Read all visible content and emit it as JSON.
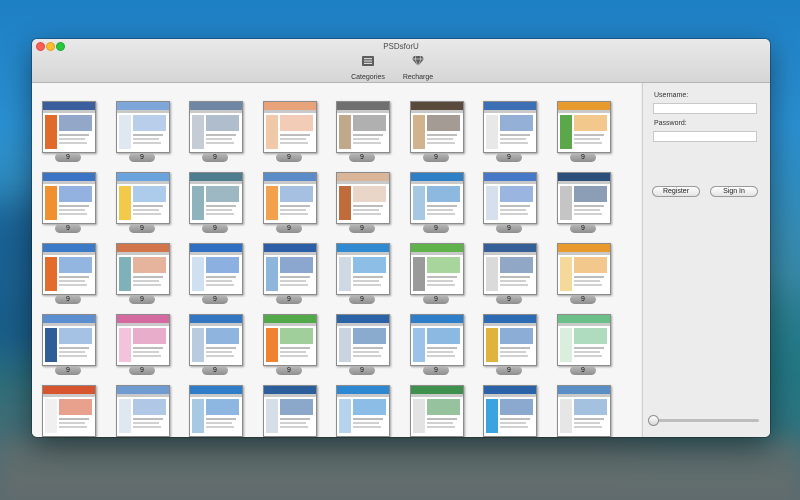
{
  "window": {
    "title": "PSDsforU"
  },
  "toolbar": {
    "items": [
      {
        "label": "Categories",
        "icon": "categories-icon"
      },
      {
        "label": "Recharge",
        "icon": "diamond-icon"
      }
    ]
  },
  "login": {
    "username_label": "Username:",
    "username_value": "",
    "password_label": "Password:",
    "password_value": "",
    "register_label": "Register",
    "signin_label": "Sign In"
  },
  "templates": {
    "badge": "9",
    "rows": [
      [
        {
          "accent": "#3b5f9c",
          "side": "#e06a2a"
        },
        {
          "accent": "#7ea6d8",
          "side": "#dfe7f2"
        },
        {
          "accent": "#6f86a4",
          "side": "#c5ccd6"
        },
        {
          "accent": "#e8a37a",
          "side": "#f0c9a8"
        },
        {
          "accent": "#707070",
          "side": "#bfa98a"
        },
        {
          "accent": "#5a4a3c",
          "side": "#d1b38e"
        },
        {
          "accent": "#3d6fb5",
          "side": "#e8e8e8"
        },
        {
          "accent": "#e79b2f",
          "side": "#5aa84a"
        }
      ],
      [
        {
          "accent": "#3b73c5",
          "side": "#f0902f"
        },
        {
          "accent": "#6aa3dc",
          "side": "#f3c94a"
        },
        {
          "accent": "#4d7d8f",
          "side": "#8fb3bd"
        },
        {
          "accent": "#5b8cc8",
          "side": "#f4a14e"
        },
        {
          "accent": "#d9b59a",
          "side": "#c06b3a"
        },
        {
          "accent": "#2f7fc7",
          "side": "#a6c8e2"
        },
        {
          "accent": "#4578c7",
          "side": "#d6e0ec"
        },
        {
          "accent": "#2b4f7a",
          "side": "#c5c5c5"
        }
      ],
      [
        {
          "accent": "#3a7ac8",
          "side": "#e36b2c"
        },
        {
          "accent": "#d2754a",
          "side": "#7fb1b8"
        },
        {
          "accent": "#2e6fc4",
          "side": "#cfe0f0"
        },
        {
          "accent": "#2d5fa8",
          "side": "#8eb5dc"
        },
        {
          "accent": "#2f8ad1",
          "side": "#cfd9e3"
        },
        {
          "accent": "#5fb34a",
          "side": "#9a9a9a"
        },
        {
          "accent": "#355f97",
          "side": "#dadada"
        },
        {
          "accent": "#e99a2d",
          "side": "#f5d99a"
        }
      ],
      [
        {
          "accent": "#5b8fcf",
          "side": "#2e5d98"
        },
        {
          "accent": "#d56aa0",
          "side": "#f2c3da"
        },
        {
          "accent": "#3376c2",
          "side": "#b9ccdf"
        },
        {
          "accent": "#53a84a",
          "side": "#f0832f"
        },
        {
          "accent": "#2a64a6",
          "side": "#c9d4e0"
        },
        {
          "accent": "#2e7fca",
          "side": "#9bc2e8"
        },
        {
          "accent": "#2d6cb5",
          "side": "#e0b43c"
        },
        {
          "accent": "#6dbf8a",
          "side": "#d9eedd"
        }
      ],
      [
        {
          "accent": "#d6542e",
          "side": "#f0f0f0"
        },
        {
          "accent": "#6f9bd0",
          "side": "#dfe7f2"
        },
        {
          "accent": "#2f7cc8",
          "side": "#a7c9e4"
        },
        {
          "accent": "#2c5e9c",
          "side": "#d6dee8"
        },
        {
          "accent": "#2e87d1",
          "side": "#b5d3ec"
        },
        {
          "accent": "#3f8f4d",
          "side": "#e3e3e3"
        },
        {
          "accent": "#2b63a8",
          "side": "#3aa3e0"
        },
        {
          "accent": "#5a8fc5",
          "side": "#e6e6e6"
        }
      ]
    ]
  }
}
